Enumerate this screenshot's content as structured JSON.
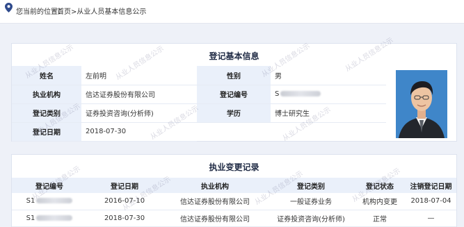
{
  "breadcrumb": {
    "label": "您当前的位置：",
    "home": "首页",
    "separator": ">",
    "current": "从业人员基本信息公示"
  },
  "watermark": "从业人员信息公示",
  "info": {
    "title": "登记基本信息",
    "name_label": "姓名",
    "name": "左前明",
    "gender_label": "性别",
    "gender": "男",
    "org_label": "执业机构",
    "org": "信达证券股份有限公司",
    "regno_label": "登记编号",
    "regno_prefix": "S",
    "category_label": "登记类别",
    "category": "证券投资咨询(分析师)",
    "edu_label": "学历",
    "edu": "博士研究生",
    "date_label": "登记日期",
    "date": "2018-07-30"
  },
  "history": {
    "title": "执业变更记录",
    "columns": [
      "登记编号",
      "登记日期",
      "执业机构",
      "登记类别",
      "登记状态",
      "注销登记日期"
    ],
    "rows": [
      {
        "regno_prefix": "S1",
        "date": "2016-07-10",
        "org": "信达证券股份有限公司",
        "category": "一般证券业务",
        "status": "机构内变更",
        "cancel_date": "2018-07-04"
      },
      {
        "regno_prefix": "S1",
        "date": "2018-07-30",
        "org": "信达证券股份有限公司",
        "category": "证券投资咨询(分析师)",
        "status": "正常",
        "cancel_date": "—"
      }
    ]
  },
  "colors": {
    "accent": "#1f2a44",
    "label_bg": "#eaf0fa",
    "photo_bg": "#3f86c9"
  }
}
